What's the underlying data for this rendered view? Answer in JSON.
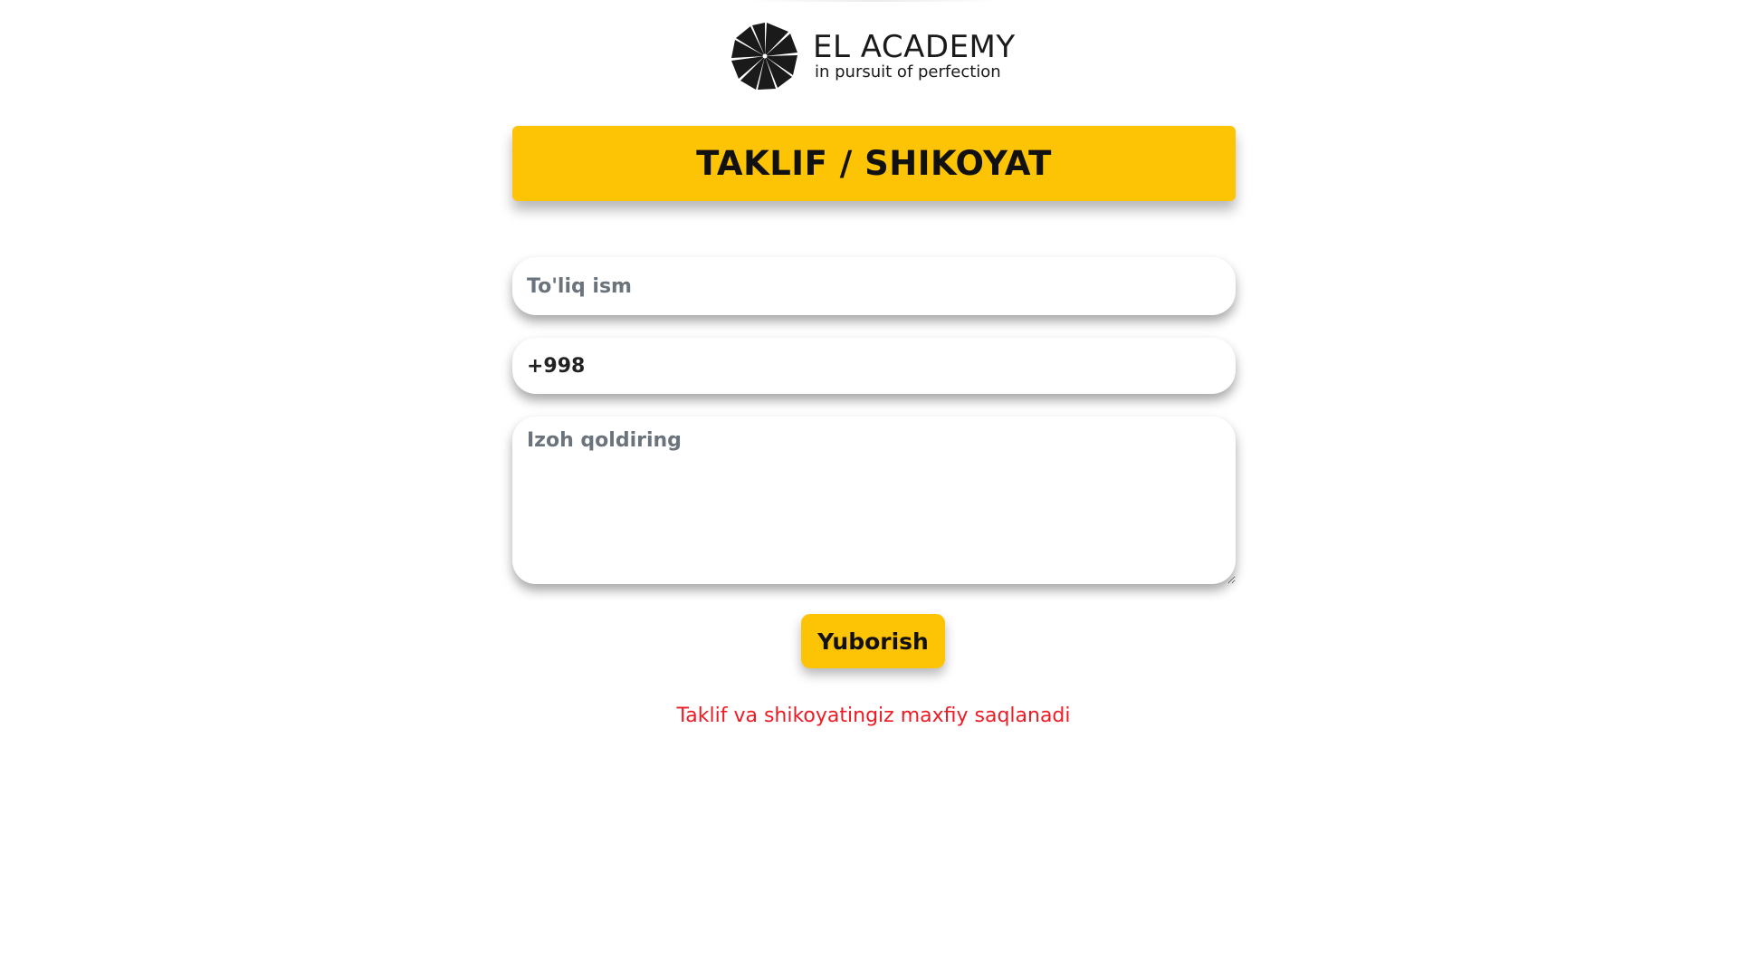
{
  "logo": {
    "icon": "umbrella-logo-icon",
    "title": "EL ACADEMY",
    "subtitle": "in pursuit of perfection"
  },
  "banner": {
    "title": "TAKLIF / SHIKOYAT",
    "color": "#fdc305"
  },
  "form": {
    "name_placeholder": "To'liq ism",
    "phone_value": "+998",
    "comment_placeholder": "Izoh qoldiring",
    "submit_label": "Yuborish"
  },
  "note": {
    "text": "Taklif va shikoyatingiz maxfiy saqlanadi",
    "color": "#ef1b24"
  }
}
